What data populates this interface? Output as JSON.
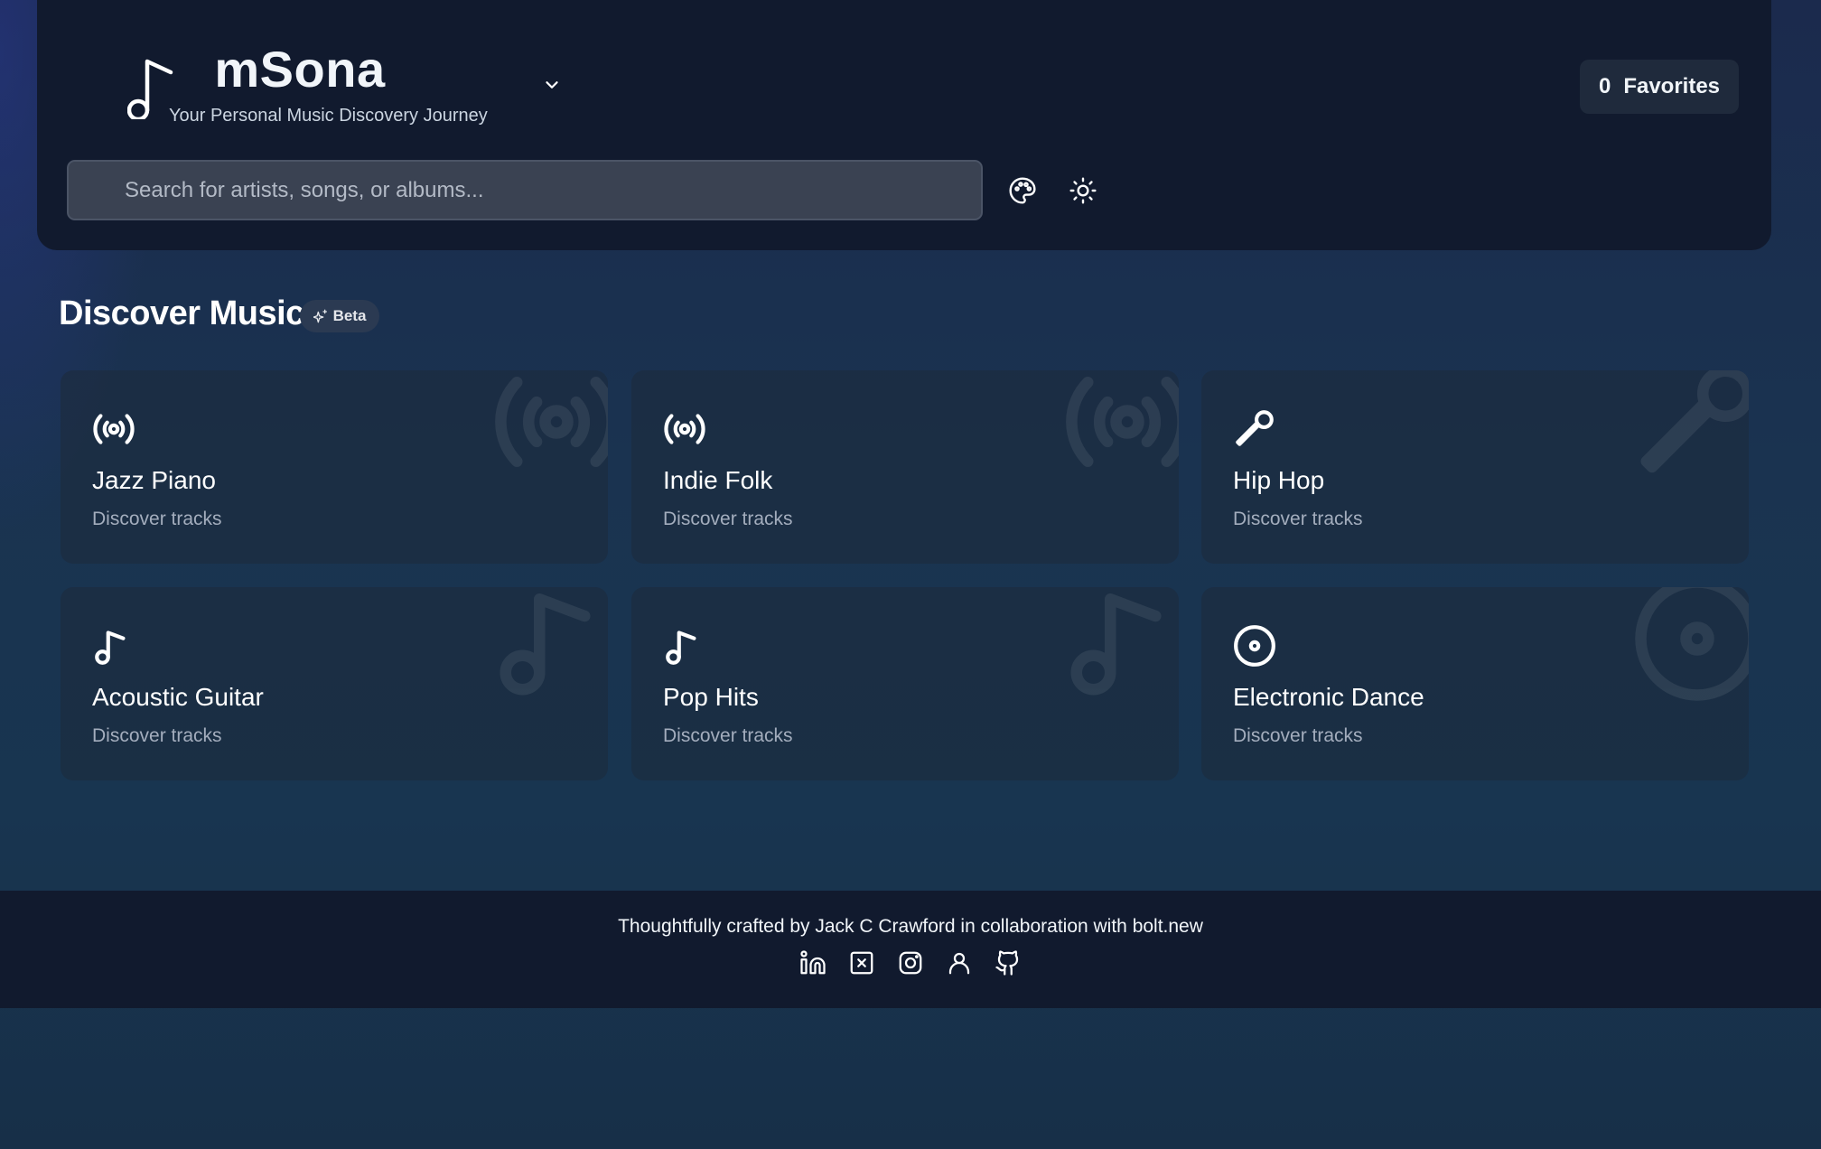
{
  "header": {
    "title": "mSona",
    "subtitle": "Your Personal Music Discovery Journey",
    "favorites_count": "0",
    "favorites_label": "Favorites",
    "search_placeholder": "Search for artists, songs, or albums...",
    "icons": [
      "music-note-icon",
      "chevron-down-icon",
      "palette-icon",
      "sun-icon"
    ]
  },
  "discover": {
    "title": "Discover Music",
    "badge": "Beta",
    "badge_icon": "sparkles-icon",
    "cards": [
      {
        "title": "Jazz Piano",
        "subtitle": "Discover tracks",
        "icon": "radio-icon"
      },
      {
        "title": "Indie Folk",
        "subtitle": "Discover tracks",
        "icon": "radio-icon"
      },
      {
        "title": "Hip Hop",
        "subtitle": "Discover tracks",
        "icon": "microphone-icon"
      },
      {
        "title": "Acoustic Guitar",
        "subtitle": "Discover tracks",
        "icon": "music-note-icon"
      },
      {
        "title": "Pop Hits",
        "subtitle": "Discover tracks",
        "icon": "music-note-icon"
      },
      {
        "title": "Electronic Dance",
        "subtitle": "Discover tracks",
        "icon": "disc-icon"
      }
    ]
  },
  "footer": {
    "credit": "Thoughtfully crafted by Jack C Crawford in collaboration with bolt.new",
    "socials": [
      "linkedin-icon",
      "x-icon",
      "instagram-icon",
      "user-icon",
      "github-icon"
    ]
  },
  "colors": {
    "header_bg": "#111a2e",
    "card_bg": "#1e293b",
    "muted_text": "#a3adbd",
    "search_bg": "#3a4252"
  }
}
